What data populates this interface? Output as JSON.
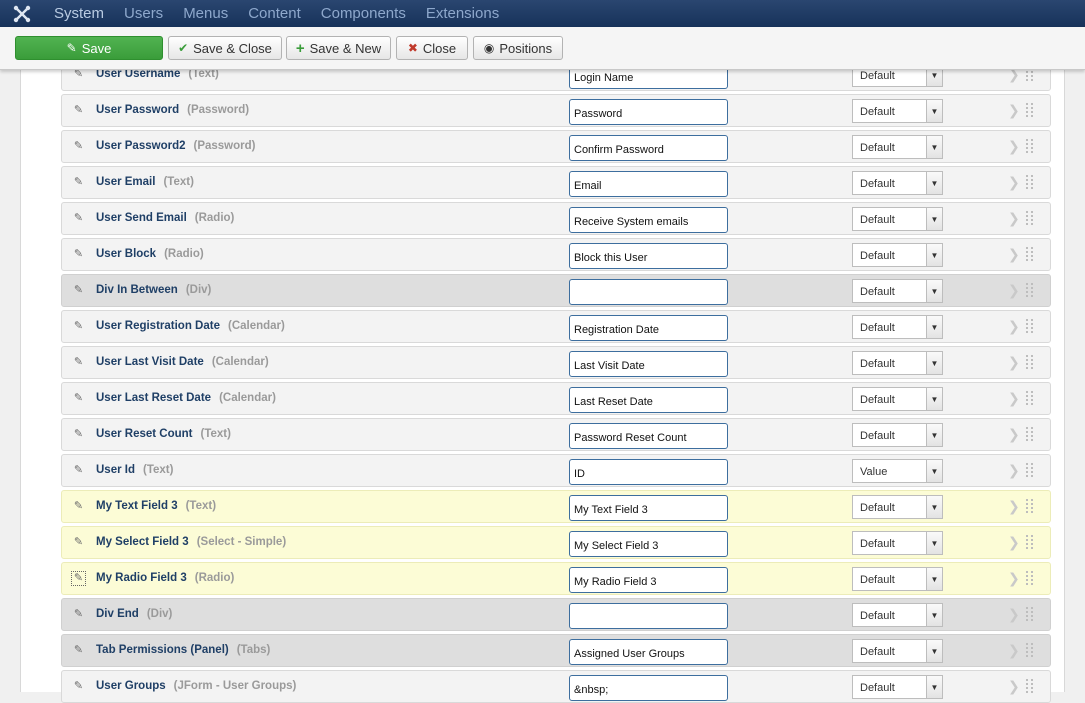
{
  "nav": {
    "logo_icon": "joomla-logo-icon",
    "items": [
      "System",
      "Users",
      "Menus",
      "Content",
      "Components",
      "Extensions"
    ]
  },
  "toolbar": {
    "save_label": "Save",
    "save_close_label": "Save & Close",
    "save_new_label": "Save & New",
    "close_label": "Close",
    "positions_label": "Positions"
  },
  "rows": [
    {
      "label": "User Username",
      "type": "(Text)",
      "value": "Login Name",
      "select": "Default",
      "style": "normal"
    },
    {
      "label": "User Password",
      "type": "(Password)",
      "value": "Password",
      "select": "Default",
      "style": "normal"
    },
    {
      "label": "User Password2",
      "type": "(Password)",
      "value": "Confirm Password",
      "select": "Default",
      "style": "normal"
    },
    {
      "label": "User Email",
      "type": "(Text)",
      "value": "Email",
      "select": "Default",
      "style": "normal"
    },
    {
      "label": "User Send Email",
      "type": "(Radio)",
      "value": "Receive System emails",
      "select": "Default",
      "style": "normal"
    },
    {
      "label": "User Block",
      "type": "(Radio)",
      "value": "Block this User",
      "select": "Default",
      "style": "normal"
    },
    {
      "label": "Div In Between",
      "type": "(Div)",
      "value": "",
      "select": "Default",
      "style": "div"
    },
    {
      "label": "User Registration Date",
      "type": "(Calendar)",
      "value": "Registration Date",
      "select": "Default",
      "style": "normal"
    },
    {
      "label": "User Last Visit Date",
      "type": "(Calendar)",
      "value": "Last Visit Date",
      "select": "Default",
      "style": "normal"
    },
    {
      "label": "User Last Reset Date",
      "type": "(Calendar)",
      "value": "Last Reset Date",
      "select": "Default",
      "style": "normal"
    },
    {
      "label": "User Reset Count",
      "type": "(Text)",
      "value": "Password Reset Count",
      "select": "Default",
      "style": "normal"
    },
    {
      "label": "User Id",
      "type": "(Text)",
      "value": "ID",
      "select": "Value",
      "style": "normal"
    },
    {
      "label": "My Text Field 3",
      "type": "(Text)",
      "value": "My Text Field 3",
      "select": "Default",
      "style": "yellow"
    },
    {
      "label": "My Select Field 3",
      "type": "(Select - Simple)",
      "value": "My Select Field 3",
      "select": "Default",
      "style": "yellow"
    },
    {
      "label": "My Radio Field 3",
      "type": "(Radio)",
      "value": "My Radio Field 3",
      "select": "Default",
      "style": "yellow"
    },
    {
      "label": "Div End",
      "type": "(Div)",
      "value": "",
      "select": "Default",
      "style": "div"
    },
    {
      "label": "Tab Permissions (Panel)",
      "type": "(Tabs)",
      "value": "Assigned User Groups",
      "select": "Default",
      "style": "div"
    },
    {
      "label": "User Groups",
      "type": "(JForm - User Groups)",
      "value": "&nbsp;",
      "select": "Default",
      "style": "normal"
    }
  ]
}
